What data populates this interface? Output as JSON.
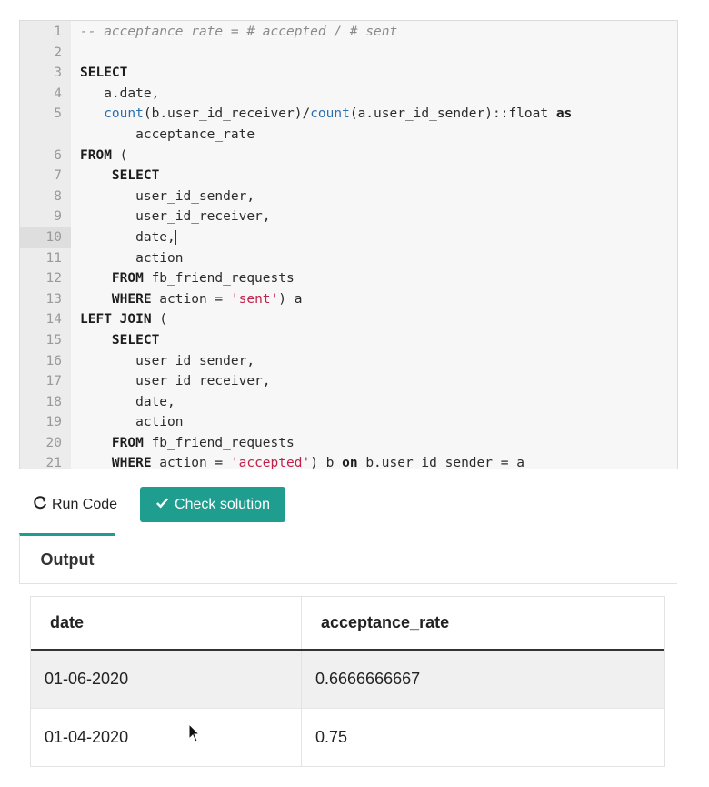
{
  "editor": {
    "lines": [
      {
        "n": "1",
        "parts": [
          {
            "t": "-- acceptance rate = # accepted / # sent",
            "c": "cm"
          }
        ]
      },
      {
        "n": "2",
        "parts": []
      },
      {
        "n": "3",
        "parts": [
          {
            "t": "SELECT",
            "c": "kw"
          }
        ]
      },
      {
        "n": "4",
        "parts": [
          {
            "t": "   a.date,",
            "c": ""
          }
        ]
      },
      {
        "n": "5",
        "wrap": true,
        "parts": [
          {
            "t": "   ",
            "c": ""
          },
          {
            "t": "count",
            "c": "fn"
          },
          {
            "t": "(b.user_id_receiver)/",
            "c": ""
          },
          {
            "t": "count",
            "c": "fn"
          },
          {
            "t": "(a.user_id_sender)::float ",
            "c": ""
          },
          {
            "t": "as",
            "c": "kw"
          },
          {
            "t": "\n       acceptance_rate",
            "c": ""
          }
        ]
      },
      {
        "n": "6",
        "parts": [
          {
            "t": "FROM",
            "c": "kw"
          },
          {
            "t": " (",
            "c": ""
          }
        ]
      },
      {
        "n": "7",
        "parts": [
          {
            "t": "    ",
            "c": ""
          },
          {
            "t": "SELECT",
            "c": "kw"
          }
        ]
      },
      {
        "n": "8",
        "parts": [
          {
            "t": "       user_id_sender,",
            "c": ""
          }
        ]
      },
      {
        "n": "9",
        "parts": [
          {
            "t": "       user_id_receiver,",
            "c": ""
          }
        ]
      },
      {
        "n": "10",
        "active": true,
        "cursor": true,
        "parts": [
          {
            "t": "       date,",
            "c": ""
          }
        ]
      },
      {
        "n": "11",
        "parts": [
          {
            "t": "       action",
            "c": ""
          }
        ]
      },
      {
        "n": "12",
        "parts": [
          {
            "t": "    ",
            "c": ""
          },
          {
            "t": "FROM",
            "c": "kw"
          },
          {
            "t": " fb_friend_requests",
            "c": ""
          }
        ]
      },
      {
        "n": "13",
        "parts": [
          {
            "t": "    ",
            "c": ""
          },
          {
            "t": "WHERE",
            "c": "kw"
          },
          {
            "t": " action = ",
            "c": ""
          },
          {
            "t": "'sent'",
            "c": "str"
          },
          {
            "t": ") a",
            "c": ""
          }
        ]
      },
      {
        "n": "14",
        "parts": [
          {
            "t": "LEFT JOIN",
            "c": "kw"
          },
          {
            "t": " (",
            "c": ""
          }
        ]
      },
      {
        "n": "15",
        "parts": [
          {
            "t": "    ",
            "c": ""
          },
          {
            "t": "SELECT",
            "c": "kw"
          }
        ]
      },
      {
        "n": "16",
        "parts": [
          {
            "t": "       user_id_sender,",
            "c": ""
          }
        ]
      },
      {
        "n": "17",
        "parts": [
          {
            "t": "       user_id_receiver,",
            "c": ""
          }
        ]
      },
      {
        "n": "18",
        "parts": [
          {
            "t": "       date,",
            "c": ""
          }
        ]
      },
      {
        "n": "19",
        "parts": [
          {
            "t": "       action",
            "c": ""
          }
        ]
      },
      {
        "n": "20",
        "parts": [
          {
            "t": "    ",
            "c": ""
          },
          {
            "t": "FROM",
            "c": "kw"
          },
          {
            "t": " fb_friend_requests",
            "c": ""
          }
        ]
      },
      {
        "n": "21",
        "parts": [
          {
            "t": "    ",
            "c": ""
          },
          {
            "t": "WHERE",
            "c": "kw"
          },
          {
            "t": " action = ",
            "c": ""
          },
          {
            "t": "'accepted'",
            "c": "str"
          },
          {
            "t": ") b ",
            "c": ""
          },
          {
            "t": "on",
            "c": "kw"
          },
          {
            "t": " b.user_id_sender = a",
            "c": ""
          }
        ]
      }
    ]
  },
  "actions": {
    "run_label": "Run Code",
    "check_label": "Check solution",
    "accent": "#1f9d8e"
  },
  "output": {
    "tab_label": "Output",
    "columns": [
      "date",
      "acceptance_rate"
    ],
    "rows": [
      [
        "01-06-2020",
        "0.6666666667"
      ],
      [
        "01-04-2020",
        "0.75"
      ]
    ]
  },
  "icons": {
    "run": "refresh-icon",
    "check": "checkmark-icon",
    "pointer": "mouse-pointer-icon"
  }
}
